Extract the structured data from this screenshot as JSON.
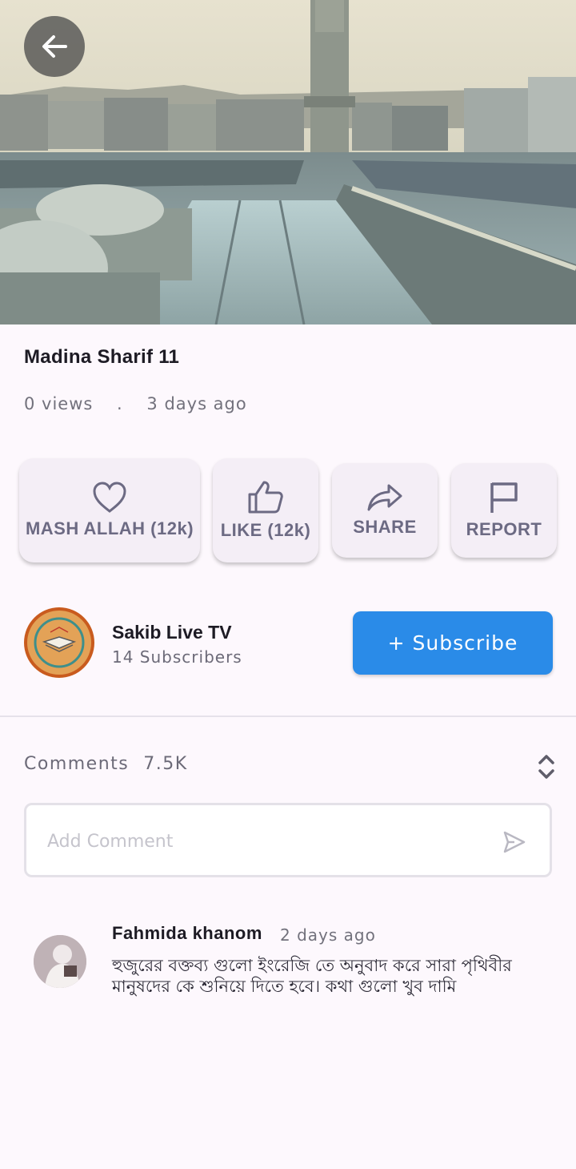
{
  "video": {
    "title": "Madina Sharif 11"
  },
  "meta": {
    "views": "0 views",
    "separator": ".",
    "posted": "3 days ago"
  },
  "actions": [
    {
      "label": "MASH ALLAH (12k)",
      "icon": "heart-icon"
    },
    {
      "label": "LIKE (12k)",
      "icon": "thumbs-up-icon"
    },
    {
      "label": "SHARE",
      "icon": "share-icon"
    },
    {
      "label": "REPORT",
      "icon": "flag-icon"
    }
  ],
  "channel": {
    "name": "Sakib Live TV",
    "subscribers": "14 Subscribers",
    "subscribe_label": "+ Subscribe"
  },
  "comments": {
    "label": "Comments",
    "count": "7.5K",
    "input_placeholder": "Add Comment",
    "items": [
      {
        "author": "Fahmida khanom",
        "time": "2 days ago",
        "text": "হুজুরের বক্তব্য গুলো ইংরেজি তে অনুবাদ করে সারা পৃথিবীর মানুষদের কে শুনিয়ে দিতে হবে। কথা গুলো খুব দামি"
      }
    ]
  },
  "colors": {
    "accent": "#2a8be8",
    "action_text": "#6c6a83",
    "background": "#fdf8fd"
  }
}
